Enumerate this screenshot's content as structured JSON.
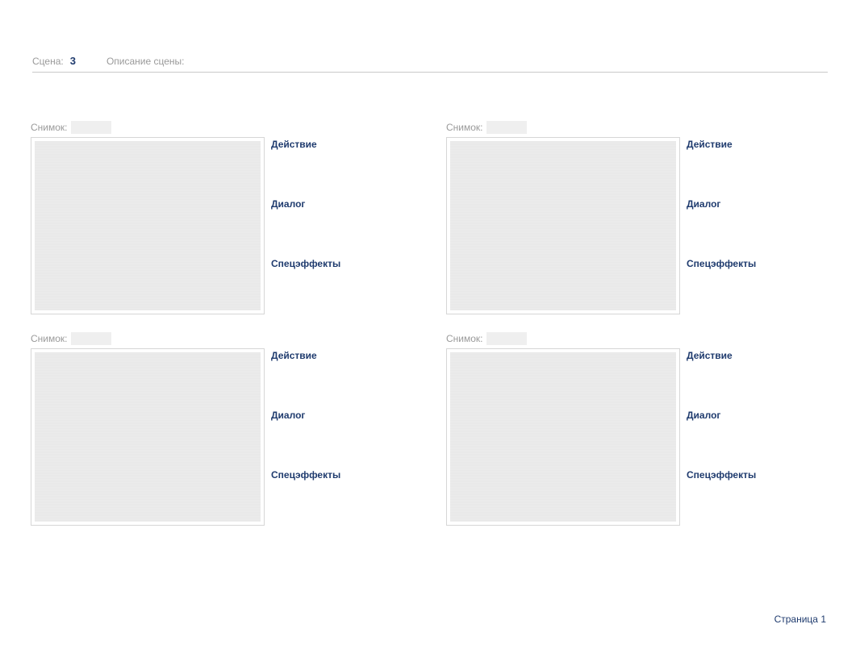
{
  "header": {
    "scene_label": "Сцена:",
    "scene_number": "3",
    "desc_label": "Описание сцены:",
    "desc_value": ""
  },
  "panels": [
    {
      "shot_label": "Снимок:",
      "shot_value": "",
      "action_label": "Действие",
      "dialog_label": "Диалог",
      "fx_label": "Спецэффекты"
    },
    {
      "shot_label": "Снимок:",
      "shot_value": "",
      "action_label": "Действие",
      "dialog_label": "Диалог",
      "fx_label": "Спецэффекты"
    },
    {
      "shot_label": "Снимок:",
      "shot_value": "",
      "action_label": "Действие",
      "dialog_label": "Диалог",
      "fx_label": "Спецэффекты"
    },
    {
      "shot_label": "Снимок:",
      "shot_value": "",
      "action_label": "Действие",
      "dialog_label": "Диалог",
      "fx_label": "Спецэффекты"
    }
  ],
  "footer": {
    "page_label": "Страница 1"
  }
}
